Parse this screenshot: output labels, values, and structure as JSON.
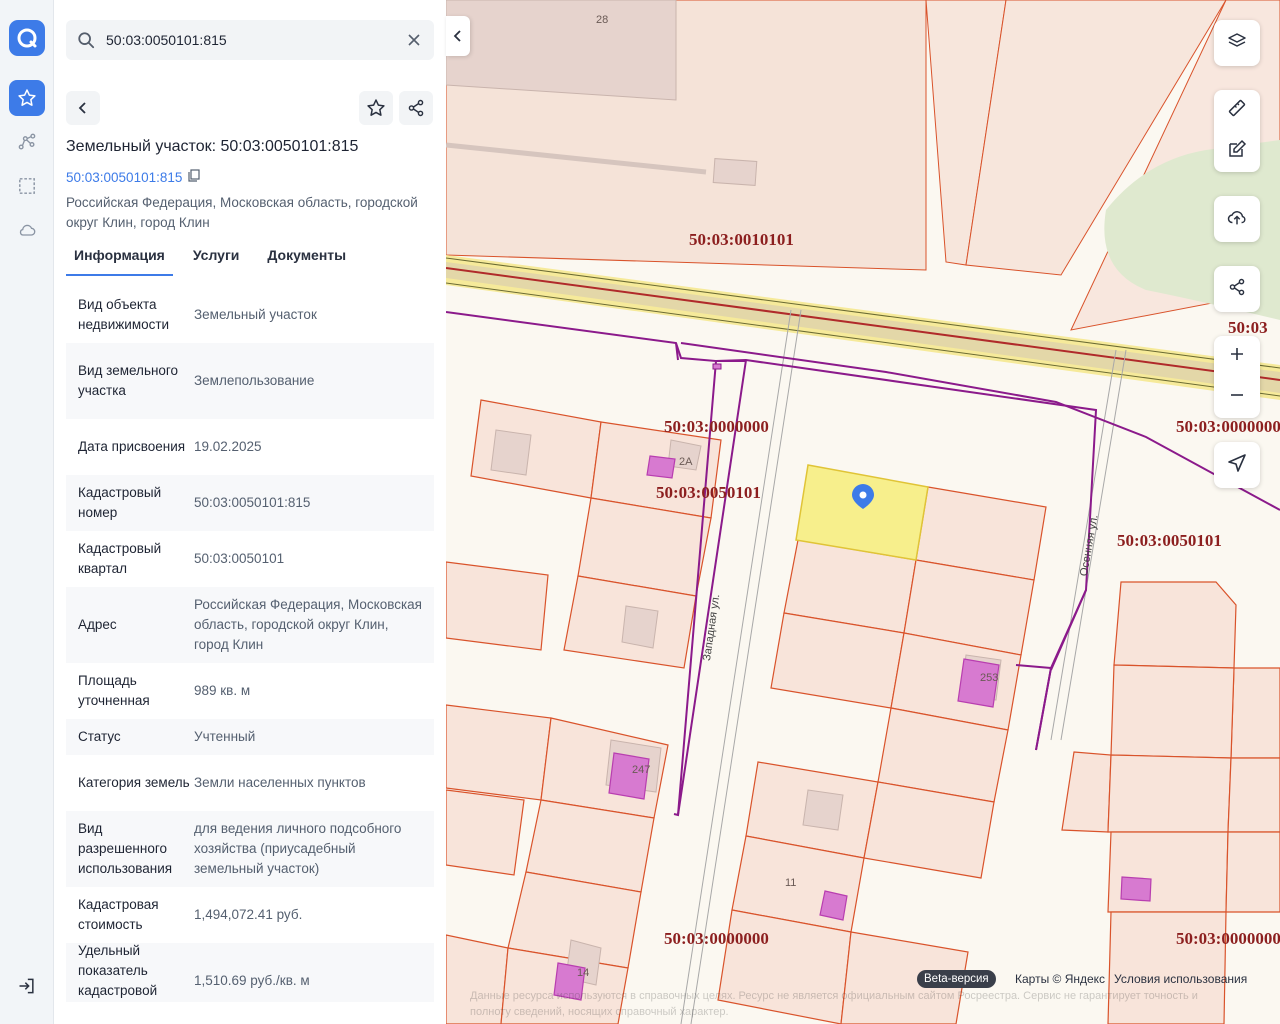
{
  "search": {
    "value": "50:03:0050101:815"
  },
  "card": {
    "title": "Земельный участок: 50:03:0050101:815",
    "cad_link": "50:03:0050101:815",
    "address": "Российская Федерация, Московская область, городской округ Клин, город Клин"
  },
  "tabs": [
    {
      "label": "Информация",
      "active": true
    },
    {
      "label": "Услуги",
      "active": false
    },
    {
      "label": "Документы",
      "active": false
    }
  ],
  "rows": [
    {
      "key": "Вид объекта недвижимости",
      "value": "Земельный участок"
    },
    {
      "key": "Вид земельного участка",
      "value": "Землепользование"
    },
    {
      "key": "Дата присвоения",
      "value": "19.02.2025"
    },
    {
      "key": "Кадастровый номер",
      "value": "50:03:0050101:815"
    },
    {
      "key": "Кадастровый квартал",
      "value": "50:03:0050101"
    },
    {
      "key": "Адрес",
      "value": "Российская Федерация, Московская область, городской округ Клин, город Клин"
    },
    {
      "key": "Площадь уточненная",
      "value": "989 кв. м"
    },
    {
      "key": "Статус",
      "value": "Учтенный"
    },
    {
      "key": "Категория земель",
      "value": "Земли населенных пунктов"
    },
    {
      "key": "Вид разрешенного использования",
      "value": "для ведения личного подсобного хозяйства (приусадебный земельный участок)"
    },
    {
      "key": "Кадастровая стоимость",
      "value": "1,494,072.41 руб."
    },
    {
      "key": "Удельный показатель кадастровой стоимости",
      "value": "1,510.69 руб./кв. м"
    }
  ],
  "map": {
    "quarter_labels": [
      "50:03:0010101",
      "50:03:0000000",
      "50:03:0050101",
      "50:03:0050101",
      "50:03:0000000",
      "50:03:0000000",
      "50:03:0000000",
      "50:03"
    ],
    "house_numbers": [
      "28",
      "2А",
      "253",
      "247",
      "11",
      "14"
    ],
    "streets": [
      "Западная ул.",
      "Осенняя ул."
    ],
    "beta": "Beta-версия",
    "attribution": "Карты © Яндекс",
    "terms": "Условия использования",
    "disclaimer": "Данные ресурса используются в справочных целях. Ресурс не является официальным сайтом Росреестра. Сервис не гарантирует точность и полноту сведений, носящих справочный характер."
  },
  "colors": {
    "accent": "#3d7be8",
    "parcel_border": "#d9532b",
    "building": "#c94fc0",
    "boundary": "#8b1a8b",
    "quarter_label": "#8c1f1f",
    "selected": "#f7ef8c"
  }
}
